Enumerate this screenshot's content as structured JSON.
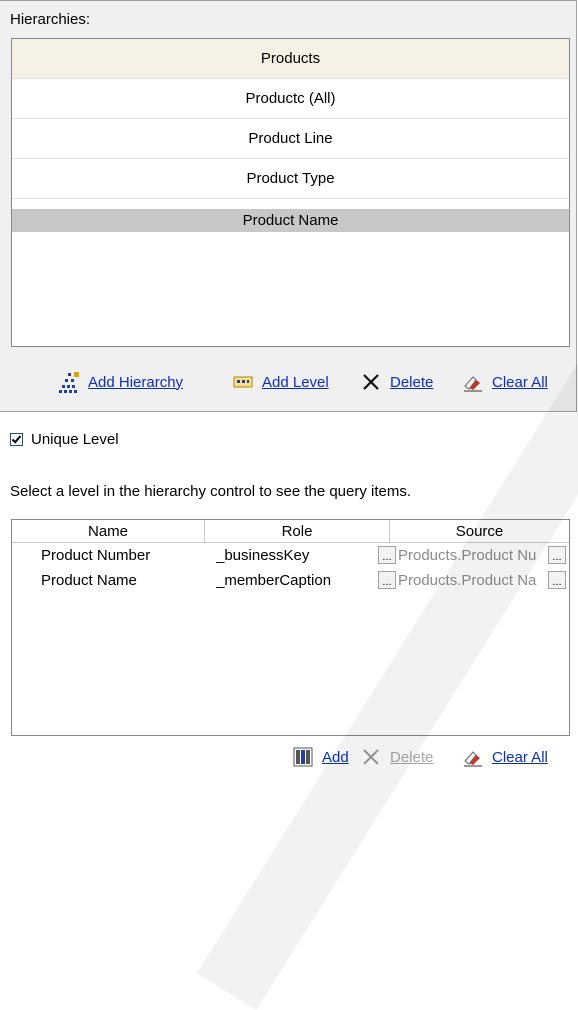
{
  "hierarchies": {
    "label": "Hierarchies:",
    "items": [
      {
        "label": "Products"
      },
      {
        "label": "Productc (All)"
      },
      {
        "label": "Product Line"
      },
      {
        "label": "Product Type"
      },
      {
        "label": "Product Name"
      }
    ],
    "toolbar": {
      "add_hierarchy": "Add Hierarchy",
      "add_level": "Add Level",
      "delete": "Delete",
      "clear_all": "Clear All"
    }
  },
  "unique_level": {
    "label": "Unique Level",
    "checked": true
  },
  "hint": "Select a level in the hierarchy control to see the query items.",
  "query_items": {
    "columns": [
      "Name",
      "Role",
      "Source"
    ],
    "rows": [
      {
        "name": "Product Number",
        "role": "_businessKey",
        "source": "Products.Product Nu"
      },
      {
        "name": "Product Name",
        "role": "_memberCaption",
        "source": "Products.Product Na"
      }
    ],
    "ellipsis": "..."
  },
  "bottom_toolbar": {
    "add": "Add",
    "delete": "Delete",
    "clear_all": "Clear All"
  },
  "colors": {
    "link": "#0b2fbf",
    "disabled": "#a8a8a8",
    "header_bg": "#f5f1e4",
    "selected_bg": "#c8c8c8"
  }
}
